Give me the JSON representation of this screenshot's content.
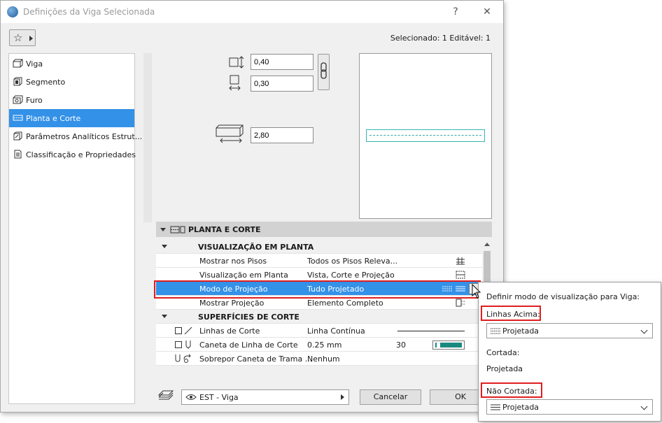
{
  "window": {
    "title": "Definições da Viga Selecionada",
    "help_symbol": "?",
    "close_symbol": "✕",
    "selection_info": "Selecionado: 1 Editável: 1"
  },
  "sidebar": {
    "items": [
      {
        "label": "Viga"
      },
      {
        "label": "Segmento"
      },
      {
        "label": "Furo"
      },
      {
        "label": "Planta e Corte"
      },
      {
        "label": "Parâmetros Analíticos Estrut..."
      },
      {
        "label": "Classificação e Propriedades"
      }
    ],
    "active_index": 3
  },
  "fields": {
    "width_value": "0,40",
    "height_value": "0,30",
    "elevation_value": "2,80"
  },
  "panel": {
    "title": "PLANTA E CORTE",
    "groups": {
      "plan_display": "VISUALIZAÇÃO EM PLANTA",
      "cut_surfaces": "SUPERFÍCIES DE CORTE"
    },
    "rows": {
      "show_on_stories": {
        "label": "Mostrar nos Pisos",
        "value": "Todos os Pisos Releva..."
      },
      "plan_display": {
        "label": "Visualização em Planta",
        "value": "Vista, Corte e Projeção"
      },
      "projection_mode": {
        "label": "Modo de Projeção",
        "value": "Tudo Projetado"
      },
      "show_projection": {
        "label": "Mostrar Projeção",
        "value": "Elemento Completo"
      },
      "cut_lines": {
        "label": "Linhas de Corte",
        "value": "Linha Contínua"
      },
      "cut_line_pen": {
        "label": "Caneta de Linha de Corte",
        "value": "0.25 mm",
        "pen_number": "30"
      },
      "override_fill_pen": {
        "label": "Sobrepor Caneta de Trama ...",
        "value": "Nenhum"
      }
    }
  },
  "bottom": {
    "layer": "EST - Viga",
    "cancel": "Cancelar",
    "ok": "OK"
  },
  "popup": {
    "heading": "Definir modo de visualização para Viga:",
    "lines_above_label": "Linhas Acima:",
    "lines_above_value": "Projetada",
    "cut_label": "Cortada:",
    "cut_value": "Projetada",
    "uncut_label": "Não Cortada:",
    "uncut_value": "Projetada"
  },
  "colors": {
    "accent": "#3391e8",
    "highlight_red": "#e01e1e",
    "pen_teal": "#1a8a80",
    "preview_line": "#35b5b5"
  }
}
